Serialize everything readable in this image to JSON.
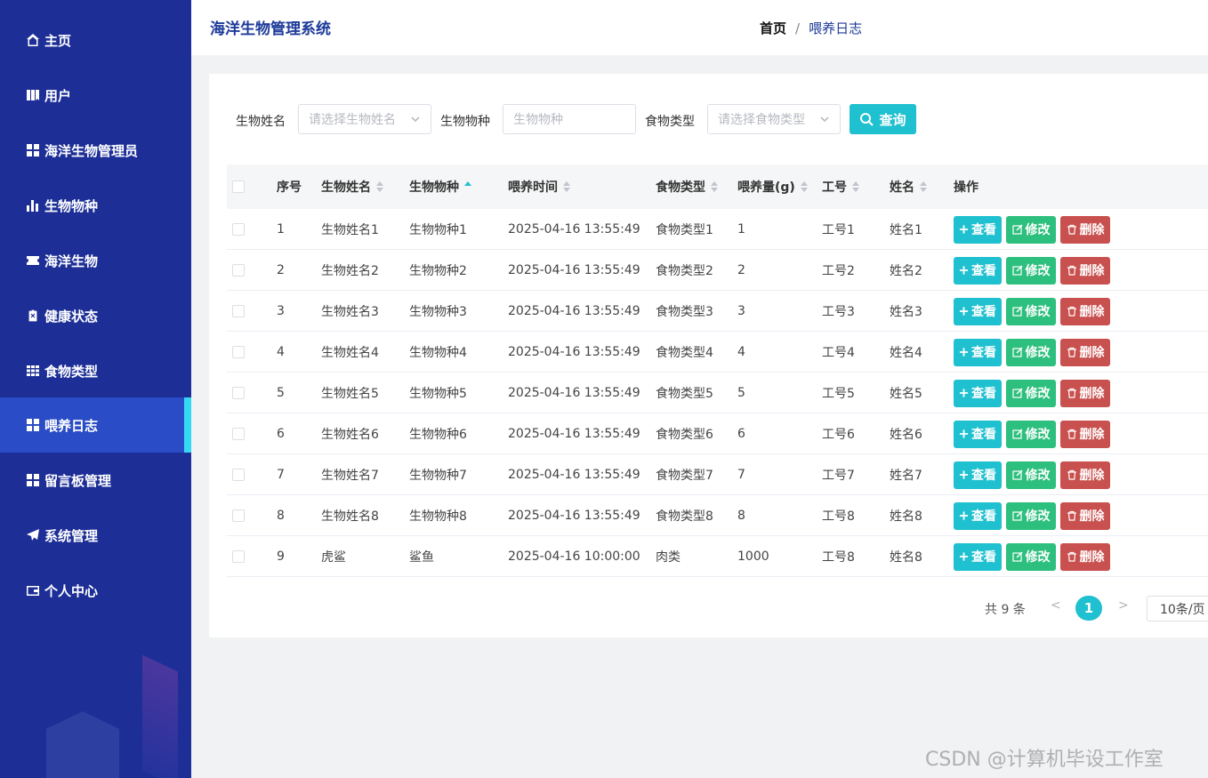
{
  "app": {
    "title": "海洋生物管理系统"
  },
  "breadcrumb": {
    "home": "首页",
    "separator": "/",
    "current": "喂养日志"
  },
  "sidebar": {
    "items": [
      {
        "label": "主页",
        "icon": "home-icon"
      },
      {
        "label": "用户",
        "icon": "users-icon"
      },
      {
        "label": "海洋生物管理员",
        "icon": "grid-icon"
      },
      {
        "label": "生物物种",
        "icon": "bar-chart-icon"
      },
      {
        "label": "海洋生物",
        "icon": "ticket-icon"
      },
      {
        "label": "健康状态",
        "icon": "clipboard-icon"
      },
      {
        "label": "食物类型",
        "icon": "table-icon"
      },
      {
        "label": "喂养日志",
        "icon": "grid-icon",
        "active": true
      },
      {
        "label": "留言板管理",
        "icon": "grid-icon"
      },
      {
        "label": "系统管理",
        "icon": "send-icon"
      },
      {
        "label": "个人中心",
        "icon": "wallet-icon"
      }
    ]
  },
  "search": {
    "name_label": "生物姓名",
    "name_placeholder": "请选择生物姓名",
    "species_label": "生物物种",
    "species_placeholder": "生物物种",
    "food_label": "食物类型",
    "food_placeholder": "请选择食物类型",
    "query_button": "查询"
  },
  "table": {
    "headers": {
      "index": "序号",
      "name": "生物姓名",
      "species": "生物物种",
      "time": "喂养时间",
      "food": "食物类型",
      "amount": "喂养量(g)",
      "staff_no": "工号",
      "staff_name": "姓名",
      "actions": "操作"
    },
    "action_labels": {
      "view": "查看",
      "edit": "修改",
      "delete": "删除"
    },
    "rows": [
      {
        "index": "1",
        "name": "生物姓名1",
        "species": "生物物种1",
        "time": "2025-04-16 13:55:49",
        "food": "食物类型1",
        "amount": "1",
        "staff_no": "工号1",
        "staff_name": "姓名1"
      },
      {
        "index": "2",
        "name": "生物姓名2",
        "species": "生物物种2",
        "time": "2025-04-16 13:55:49",
        "food": "食物类型2",
        "amount": "2",
        "staff_no": "工号2",
        "staff_name": "姓名2"
      },
      {
        "index": "3",
        "name": "生物姓名3",
        "species": "生物物种3",
        "time": "2025-04-16 13:55:49",
        "food": "食物类型3",
        "amount": "3",
        "staff_no": "工号3",
        "staff_name": "姓名3"
      },
      {
        "index": "4",
        "name": "生物姓名4",
        "species": "生物物种4",
        "time": "2025-04-16 13:55:49",
        "food": "食物类型4",
        "amount": "4",
        "staff_no": "工号4",
        "staff_name": "姓名4"
      },
      {
        "index": "5",
        "name": "生物姓名5",
        "species": "生物物种5",
        "time": "2025-04-16 13:55:49",
        "food": "食物类型5",
        "amount": "5",
        "staff_no": "工号5",
        "staff_name": "姓名5"
      },
      {
        "index": "6",
        "name": "生物姓名6",
        "species": "生物物种6",
        "time": "2025-04-16 13:55:49",
        "food": "食物类型6",
        "amount": "6",
        "staff_no": "工号6",
        "staff_name": "姓名6"
      },
      {
        "index": "7",
        "name": "生物姓名7",
        "species": "生物物种7",
        "time": "2025-04-16 13:55:49",
        "food": "食物类型7",
        "amount": "7",
        "staff_no": "工号7",
        "staff_name": "姓名7"
      },
      {
        "index": "8",
        "name": "生物姓名8",
        "species": "生物物种8",
        "time": "2025-04-16 13:55:49",
        "food": "食物类型8",
        "amount": "8",
        "staff_no": "工号8",
        "staff_name": "姓名8"
      },
      {
        "index": "9",
        "name": "虎鲨",
        "species": "鲨鱼",
        "time": "2025-04-16 10:00:00",
        "food": "肉类",
        "amount": "1000",
        "staff_no": "工号8",
        "staff_name": "姓名8"
      }
    ]
  },
  "pagination": {
    "total": "共 9 条",
    "prev": "<",
    "current_page": "1",
    "next": ">",
    "page_size": "10条/页"
  },
  "watermark": "CSDN @计算机毕设工作室",
  "colors": {
    "sidebar": "#1d2f97",
    "accent": "#1fc0cf",
    "edit": "#2dbf7d",
    "delete": "#c8504e"
  }
}
